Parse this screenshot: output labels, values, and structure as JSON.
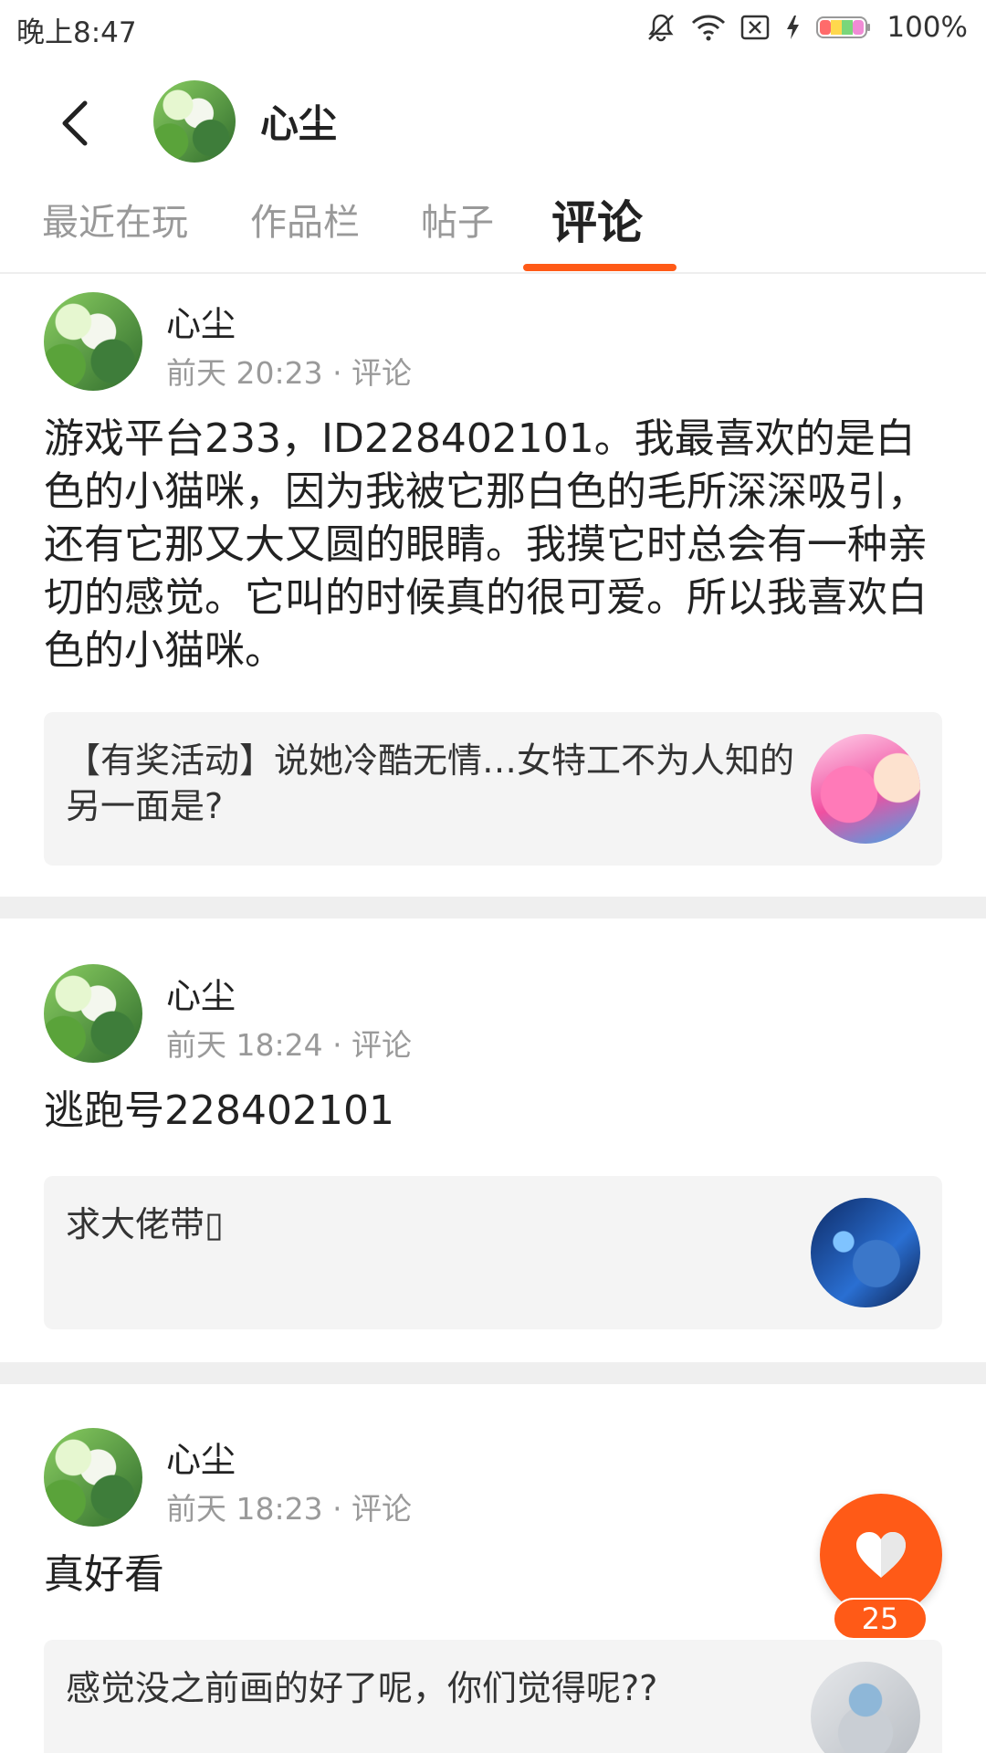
{
  "status_bar": {
    "time": "晚上8:47",
    "battery": "100%",
    "icons": [
      "bell-muted-icon",
      "wifi-icon",
      "sim-disabled-icon",
      "charging-icon",
      "battery-icon"
    ]
  },
  "header": {
    "back_icon": "chevron-left-icon",
    "title": "心尘"
  },
  "tabs": [
    {
      "label": "最近在玩",
      "active": false
    },
    {
      "label": "作品栏",
      "active": false
    },
    {
      "label": "帖子",
      "active": false
    },
    {
      "label": "评论",
      "active": true
    }
  ],
  "accent_color": "#ff5a17",
  "comments": [
    {
      "author": "心尘",
      "meta": "前天 20:23 · 评论",
      "body": "游戏平台233，ID228402101。我最喜欢的是白色的小猫咪，因为我被它那白色的毛所深深吸引，还有它那又大又圆的眼睛。我摸它时总会有一种亲切的感觉。它叫的时候真的很可爱。所以我喜欢白色的小猫咪。",
      "quote": "【有奖活动】说她冷酷无情…女特工不为人知的另一面是?"
    },
    {
      "author": "心尘",
      "meta": "前天 18:24 · 评论",
      "body": "逃跑号228402101",
      "quote": "求大佬带▯"
    },
    {
      "author": "心尘",
      "meta": "前天 18:23 · 评论",
      "body": "真好看",
      "quote": "感觉没之前画的好了呢，你们觉得呢??"
    }
  ],
  "like_button": {
    "icon": "heart-icon",
    "count": "25"
  }
}
